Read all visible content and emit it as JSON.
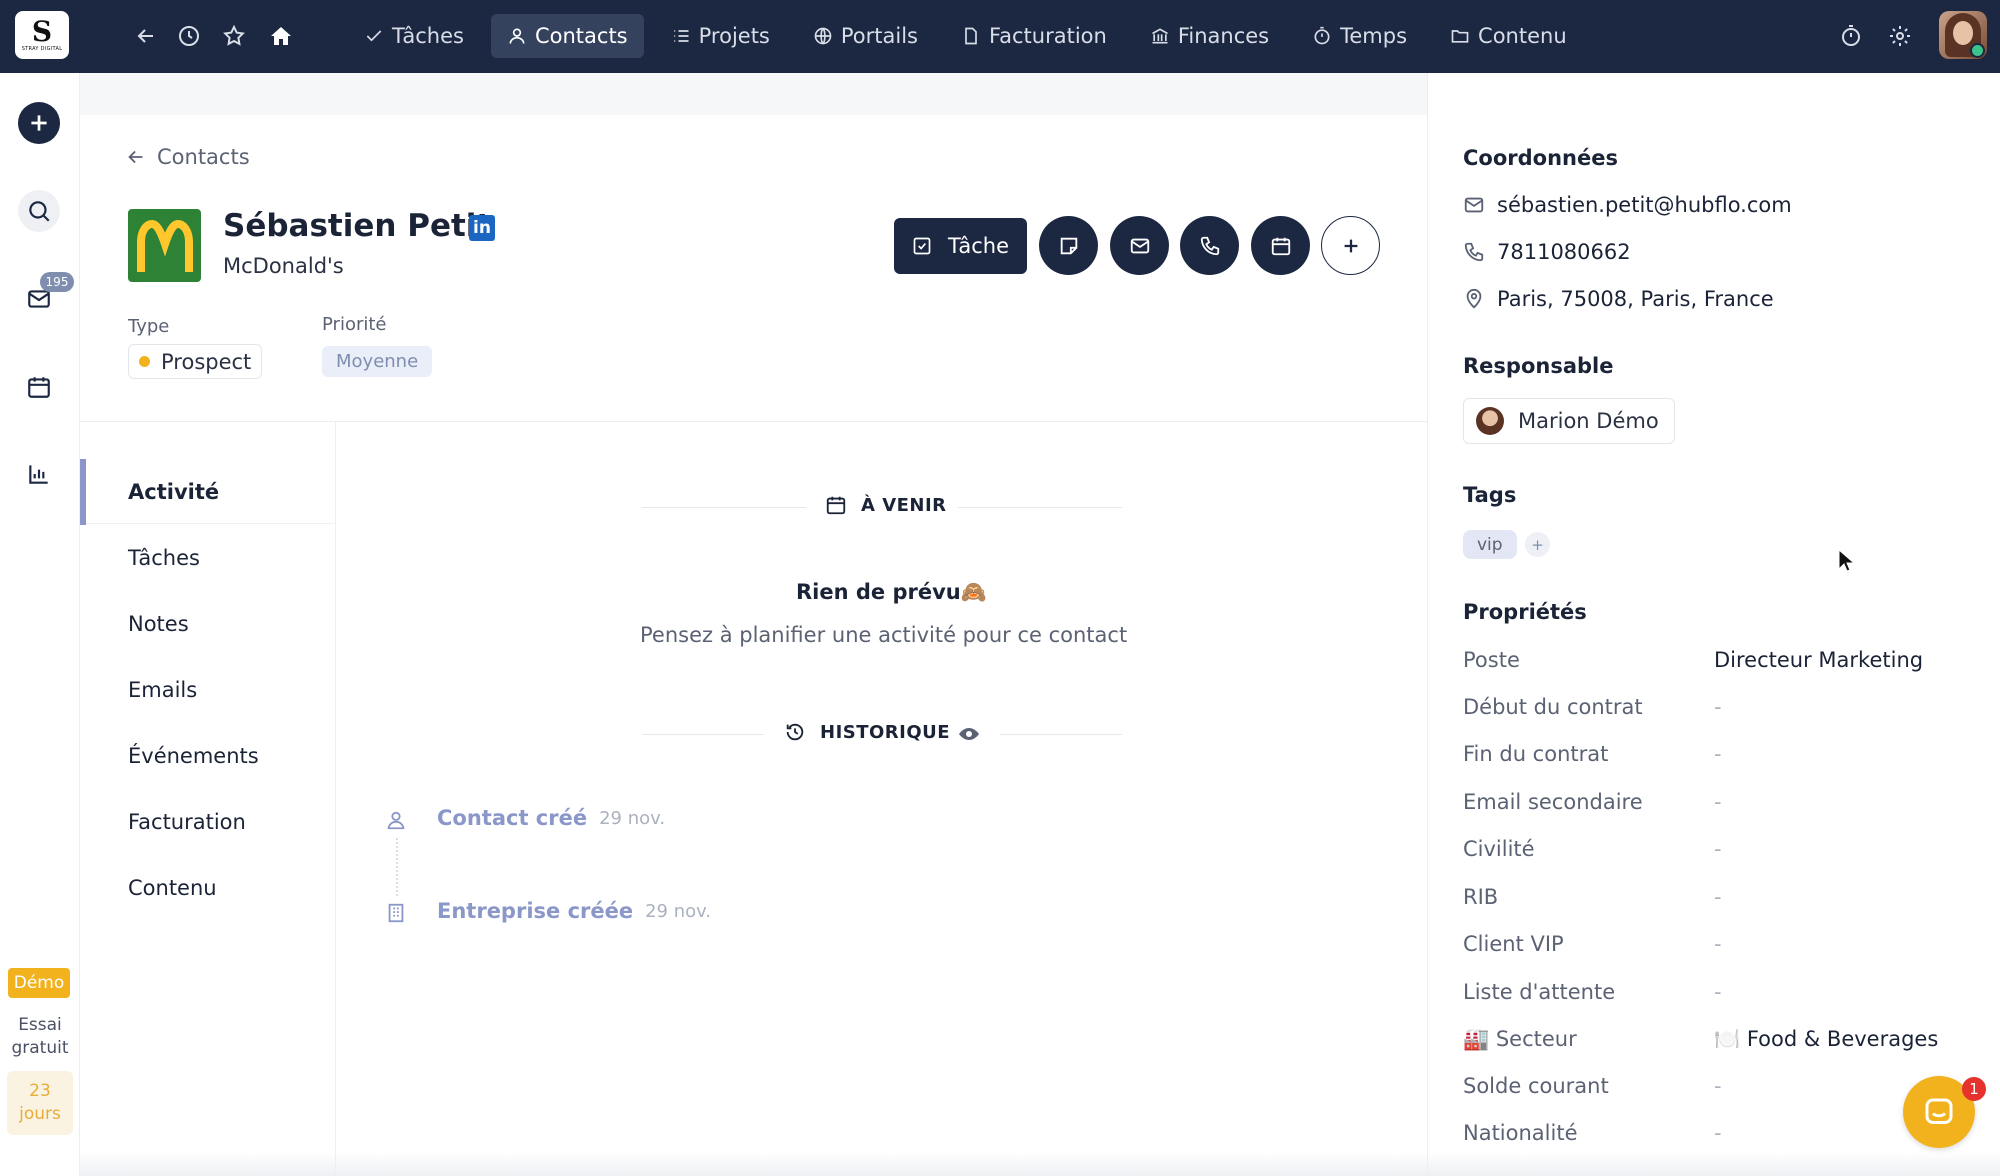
{
  "app": {
    "logo_text": "S",
    "logo_sub": "STRAY DIGITAL"
  },
  "topnav": {
    "items": [
      {
        "label": "Tâches",
        "icon": "check-icon"
      },
      {
        "label": "Contacts",
        "icon": "user-icon",
        "active": true
      },
      {
        "label": "Projets",
        "icon": "list-icon"
      },
      {
        "label": "Portails",
        "icon": "globe-icon"
      },
      {
        "label": "Facturation",
        "icon": "file-icon"
      },
      {
        "label": "Finances",
        "icon": "bank-icon"
      },
      {
        "label": "Temps",
        "icon": "stopwatch-icon"
      },
      {
        "label": "Contenu",
        "icon": "folder-icon"
      }
    ]
  },
  "rail": {
    "mail_count": "195",
    "demo_label": "Démo",
    "trial_label": "Essai gratuit",
    "trial_days": "23 jours"
  },
  "contact": {
    "back_label": "Contacts",
    "name": "Sébastien Petit",
    "linkedin_glyph": "in",
    "company": "McDonald's",
    "type_label": "Type",
    "type_value": "Prospect",
    "priority_label": "Priorité",
    "priority_value": "Moyenne",
    "task_button": "Tâche"
  },
  "tabs": [
    {
      "label": "Activité",
      "active": true
    },
    {
      "label": "Tâches"
    },
    {
      "label": "Notes"
    },
    {
      "label": "Emails"
    },
    {
      "label": "Événements"
    },
    {
      "label": "Facturation"
    },
    {
      "label": "Contenu"
    }
  ],
  "activity": {
    "upcoming_title": "À VENIR",
    "empty_title": "Rien de prévu🙈",
    "empty_sub": "Pensez à planifier une activité pour ce contact",
    "history_title": "HISTORIQUE",
    "history": [
      {
        "label": "Contact créé",
        "date": "29 nov."
      },
      {
        "label": "Entreprise créée",
        "date": "29 nov."
      }
    ]
  },
  "panel": {
    "contact_title": "Coordonnées",
    "email": "sébastien.petit@hubflo.com",
    "phone": "7811080662",
    "address": "Paris, 75008, Paris, France",
    "owner_title": "Responsable",
    "owner": "Marion Démo",
    "tags_title": "Tags",
    "tags": [
      "vip"
    ],
    "tag_add": "+",
    "props_title": "Propriétés",
    "props": [
      {
        "label": "Poste",
        "value": "Directeur Marketing"
      },
      {
        "label": "Début du contrat",
        "value": "-"
      },
      {
        "label": "Fin du contrat",
        "value": "-"
      },
      {
        "label": "Email secondaire",
        "value": "-"
      },
      {
        "label": "Civilité",
        "value": "-"
      },
      {
        "label": "RIB",
        "value": "-"
      },
      {
        "label": "Client VIP",
        "value": "-"
      },
      {
        "label": "Liste d'attente",
        "value": "-"
      },
      {
        "label": "🏭 Secteur",
        "value": "🍽️ Food & Beverages"
      },
      {
        "label": "Solde courant",
        "value": "-"
      },
      {
        "label": "Nationalité",
        "value": "-"
      }
    ]
  },
  "chat": {
    "unread": "1"
  }
}
